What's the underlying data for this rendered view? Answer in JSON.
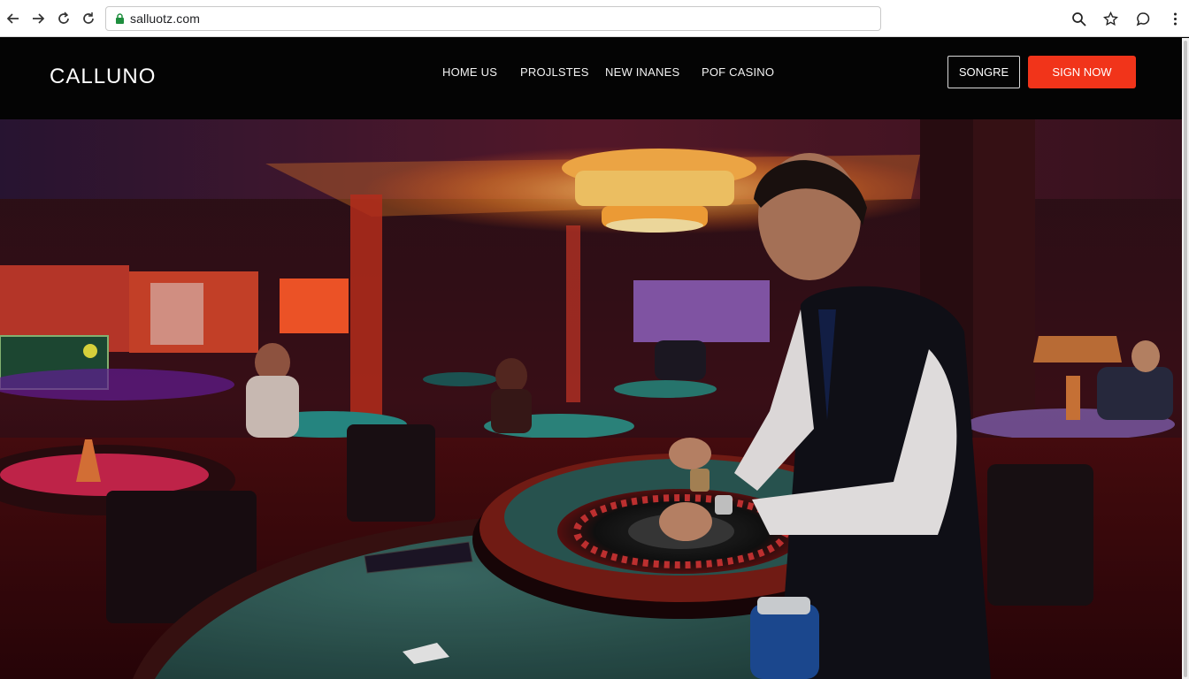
{
  "browser": {
    "url": "salluotz.com",
    "icons": [
      "back-icon",
      "forward-icon",
      "reload-icon",
      "refresh-icon",
      "lock-icon",
      "search-icon",
      "star-icon",
      "chat-icon",
      "menu-icon"
    ]
  },
  "site": {
    "logo": "CALLUNO",
    "nav": [
      "HOME US",
      "PROJLSTES",
      "NEW INANES",
      "POF CASINO"
    ],
    "signin_label": "SONGRE",
    "signup_label": "SIGN NOW"
  },
  "colors": {
    "accent": "#f1341a",
    "header_bg": "#040404",
    "felt": "#2f5b57"
  }
}
